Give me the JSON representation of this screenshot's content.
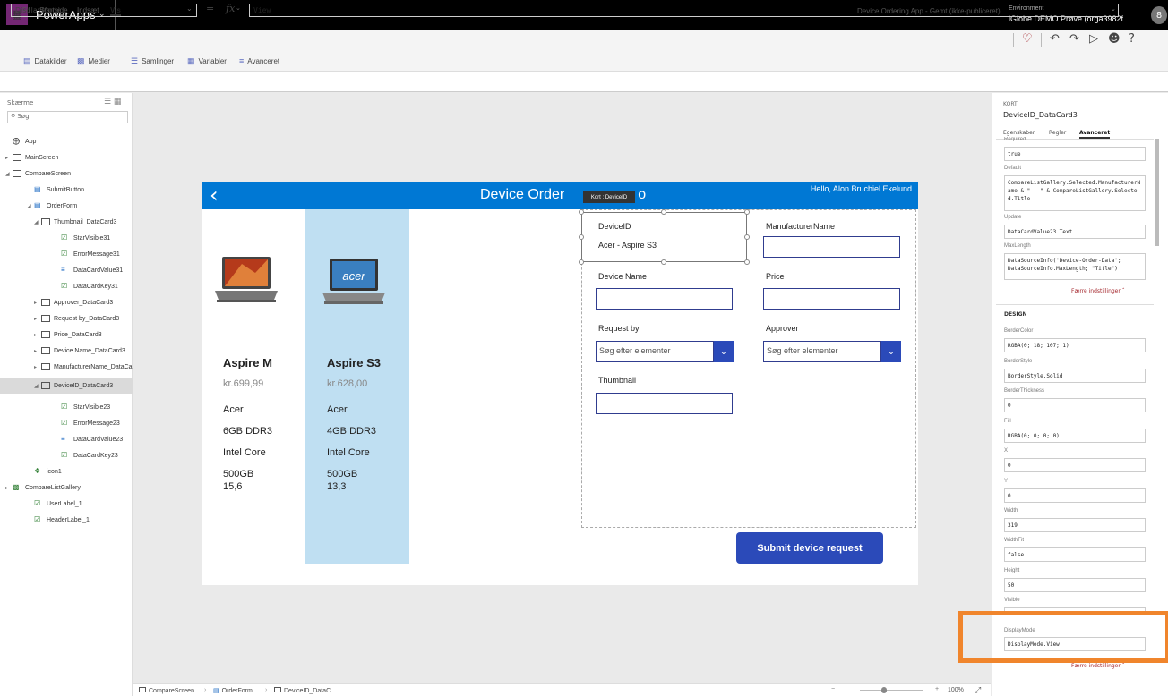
{
  "topbar": {
    "app_title": "PowerApps",
    "env_label": "Environment",
    "env_name": "iGlobe DEMO Prøve (orga3982f...",
    "avatar": "8"
  },
  "menu": {
    "items": [
      "Fil",
      "Startside",
      "Indsæt",
      "Vis"
    ],
    "save_status": "Device Ordering App - Gemt (ikke-publiceret)"
  },
  "ribbon": {
    "items": [
      "Datakilder",
      "Medier",
      "Samlinger",
      "Variabler",
      "Avanceret"
    ]
  },
  "formula": {
    "property": "DisplayMode",
    "equals": "=",
    "fx": "fx",
    "value": "View"
  },
  "left_panel": {
    "title": "Skærme",
    "search_placeholder": "Søg",
    "tree": [
      "App",
      "MainScreen",
      "CompareScreen",
      "SubmitButton",
      "OrderForm",
      "Thumbnail_DataCard3",
      "StarVisible31",
      "ErrorMessage31",
      "DataCardValue31",
      "DataCardKey31",
      "Approver_DataCard3",
      "Request by_DataCard3",
      "Price_DataCard3",
      "Device Name_DataCard3",
      "ManufacturerName_DataCa",
      "DeviceID_DataCard3",
      "StarVisible23",
      "ErrorMessage23",
      "DataCardValue23",
      "DataCardKey23",
      "icon1",
      "CompareListGallery",
      "UserLabel_1",
      "HeaderLabel_1"
    ]
  },
  "app": {
    "header_title": "Device Order",
    "header_title_suffix": "o",
    "hello": "Hello, Alon Bruchiel Ekelund",
    "tooltip": "Kort : DeviceID",
    "gallery": [
      {
        "name": "Aspire M",
        "price": "kr.699,99",
        "brand": "Acer",
        "ram": "6GB DDR3",
        "cpu": "Intel Core",
        "disk": "500GB",
        "screen": "15,6"
      },
      {
        "name": "Aspire S3",
        "price": "kr.628,00",
        "brand": "Acer",
        "ram": "4GB DDR3",
        "cpu": "Intel Core",
        "disk": "500GB",
        "screen": "13,3"
      }
    ],
    "form": {
      "deviceid_label": "DeviceID",
      "deviceid_value": "Acer - Aspire S3",
      "manufacturer_label": "ManufacturerName",
      "devicename_label": "Device Name",
      "price_label": "Price",
      "requestby_label": "Request by",
      "approver_label": "Approver",
      "search_placeholder": "Søg efter elementer",
      "thumbnail_label": "Thumbnail"
    },
    "submit_label": "Submit device request",
    "acer_logo": "acer"
  },
  "bottom": {
    "crumbs": [
      "CompareScreen",
      "OrderForm",
      "DeviceID_DataC..."
    ],
    "zoom_minus": "−",
    "zoom_plus": "+",
    "zoom": "100%"
  },
  "right_panel": {
    "kort_label": "KORT",
    "card_name": "DeviceID_DataCard3",
    "tabs": [
      "Egenskaber",
      "Regler",
      "Avanceret"
    ],
    "required_label": "Required",
    "required_value": "true",
    "default_label": "Default",
    "default_value": "CompareListGallery.Selected.ManufacturerName & \" - \" & CompareListGallery.Selected.Title",
    "update_label": "Update",
    "update_value": "DataCardValue23.Text",
    "maxlength_label": "MaxLength",
    "maxlength_value": "DataSourceInfo('Device-Order-Data'; DataSourceInfo.MaxLength; \"Title\")",
    "fewer_label": "Færre indstillinger",
    "design_label": "DESIGN",
    "bordercolor_label": "BorderColor",
    "bordercolor_value": "RGBA(0; 18; 107; 1)",
    "borderstyle_label": "BorderStyle",
    "borderstyle_value": "BorderStyle.Solid",
    "borderthickness_label": "BorderThickness",
    "borderthickness_value": "0",
    "fill_label": "Fill",
    "fill_value": "RGBA(0; 0; 0; 0)",
    "x_label": "X",
    "x_value": "0",
    "y_label": "Y",
    "y_value": "0",
    "width_label": "Width",
    "width_value": "319",
    "widthfit_label": "WidthFit",
    "widthfit_value": "false",
    "height_label": "Height",
    "height_value": "50",
    "visible_label": "Visible",
    "displaymode_label": "DisplayMode",
    "displaymode_value": "DisplayMode.View"
  },
  "colors": {
    "accent": "#0078d4",
    "button": "#2b4ab9",
    "selected_item": "#bfdff2",
    "highlight": "#f0852c",
    "brand": "#742774"
  }
}
